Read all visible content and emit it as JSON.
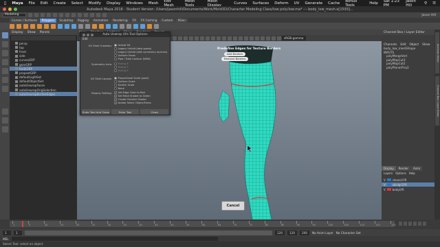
{
  "mac_menubar": {
    "apple": "",
    "app": "Maya",
    "items": [
      "File",
      "Edit",
      "Create",
      "Select",
      "Modify",
      "Display",
      "Windows",
      "Mesh",
      "Edit Mesh",
      "Mesh Tools",
      "Mesh Display",
      "Curves",
      "Surfaces",
      "Deform",
      "UV",
      "Generate",
      "Cache",
      "Bonus Tools",
      "Help"
    ],
    "time": "Sat 1:23 PM",
    "user": "Jason Hill"
  },
  "window_title": "Autodesk Maya 2016 - Student Version: /Users/jasonhill/Documents/Work/Mold3D/Character Modeling Class/low poly/low.ma* --- body_low_mesh.e[1593]...",
  "status_line": {
    "mode": "Modeling",
    "user_label": "Jason Hill"
  },
  "shelf": {
    "tabs": [
      "Curves / Surfaces",
      "Polygons",
      "Sculpting",
      "Rigging",
      "Animation",
      "Rendering",
      "FX",
      "FX Caching",
      "Custom",
      "XGen"
    ],
    "active_tab": "Polygons",
    "icon_colors": [
      "#d98b3a",
      "#d98b3a",
      "#d98b3a",
      "#d98b3a",
      "#d98b3a",
      "#d98b3a",
      "#d98b3a",
      "#5aa0d8",
      "#5aa0d8",
      "#5aa0d8",
      "#8a8a8a",
      "#8a8a8a",
      "#d98b3a",
      "#d98b3a",
      "#5aa0d8",
      "#5aa0d8",
      "#8a8a8a",
      "#8a8a8a",
      "#5aa0d8",
      "#5aa0d8",
      "#d98b3a",
      "#8a8a8a"
    ]
  },
  "outliner": {
    "menu": [
      "Display",
      "Show",
      "Panels"
    ],
    "rows": [
      {
        "label": "persp",
        "selected": false
      },
      {
        "label": "top",
        "selected": false
      },
      {
        "label": "front",
        "selected": false
      },
      {
        "label": "side",
        "selected": false
      },
      {
        "label": "curvesGRP",
        "selected": false
      },
      {
        "label": "gearGRP",
        "selected": false
      },
      {
        "label": "bodyGRP",
        "selected": true
      },
      {
        "label": "propsetGRP",
        "selected": false
      },
      {
        "label": "defaultLightSet",
        "selected": false
      },
      {
        "label": "defaultObjectSet",
        "selected": false
      },
      {
        "label": "autoUnwrapFaces",
        "selected": false
      },
      {
        "label": "autoUnwrapOrigSelection",
        "selected": false
      },
      {
        "label": "autoUnwrapBorderEdges",
        "selected": true
      }
    ]
  },
  "viewport": {
    "menu": [
      "View",
      "Shading",
      "Lighting",
      "Show",
      "Renderer",
      "Panels"
    ],
    "gamma": "sRGB gamma",
    "overlay_title": "Predefine Edges for Texture Borders",
    "pill_add": "Add Borders",
    "pill_remove": "Remove Borders",
    "cancel": "Cancel"
  },
  "dialog": {
    "title": "Auto Unwrap UVs Tool Options",
    "menu": "Edit",
    "uv_shell_creation_label": "UV Shell Creation:",
    "uv_shell_options": [
      {
        "label": "Unfold 3D",
        "on": true,
        "dim": false
      },
      {
        "label": "Legacy Unfold (best guess)",
        "on": false,
        "dim": false
      },
      {
        "label": "Legacy Unfold (with symmetry anchors)",
        "on": false,
        "dim": false
      },
      {
        "label": "Uniform Faces",
        "on": false,
        "dim": false
      },
      {
        "label": "Pipe / Tube Contour (NEW)",
        "on": false,
        "dim": false
      }
    ],
    "symmetry_label": "Symmetry Axis:",
    "symmetry_options": [
      {
        "label": "Facing X",
        "dim": true
      },
      {
        "label": "Facing Y",
        "dim": true
      },
      {
        "label": "Facing Z",
        "dim": true
      }
    ],
    "shell_layout_label": "UV Shell Layout:",
    "shell_layout_options": [
      {
        "label": "Proportional Scale (pack)",
        "on": true
      },
      {
        "label": "Uniform Scale",
        "on": false
      },
      {
        "label": "Stretch Scale",
        "on": false
      },
      {
        "label": "None",
        "on": false
      }
    ],
    "display_label": "Display Setting:",
    "display_options": [
      {
        "label": "Set Edge Color to Red",
        "checked": true
      },
      {
        "label": "Set Mesh Shader to Green",
        "checked": true
      },
      {
        "label": "Create Checker Shader",
        "checked": true
      },
      {
        "label": "Isolate Select Object/Faces",
        "checked": true
      }
    ],
    "buttons": [
      "Enter Tool And Close",
      "Enter Tool",
      "Close"
    ]
  },
  "channel_box": {
    "header": "Channel Box / Layer Editor",
    "object": "body_low_meshShape",
    "inputs_label": "INPUTS",
    "inputs": [
      "polyMergeVert",
      "polyMapCut3",
      "polyMapCut2",
      "polyPlanarProj3"
    ],
    "menu": [
      "Channels",
      "Edit",
      "Object",
      "Show"
    ],
    "layer_tabs": [
      "Display",
      "Render",
      "Anim"
    ],
    "layer_menu": [
      "Layers",
      "Options",
      "Help"
    ],
    "layers": [
      {
        "label": "clones1YR",
        "color": "#2a78c8",
        "selected": false
      },
      {
        "label": "skinlgr1YR",
        "color": "#2a78c8",
        "selected": true
      },
      {
        "label": "bodyLYR",
        "color": "#d43a3a",
        "selected": false
      }
    ]
  },
  "side_tabs": [
    "Attribute Editor",
    "Channel Box / Layer Editor"
  ],
  "timeline": {
    "ticks": [
      "1",
      "5",
      "10",
      "15",
      "20",
      "25",
      "30",
      "35",
      "40",
      "45",
      "50",
      "55",
      "60",
      "65",
      "70",
      "75",
      "80",
      "85",
      "90",
      "95",
      "100",
      "105",
      "110",
      "115",
      "120"
    ],
    "current_frame": "1"
  },
  "range": {
    "start": "1",
    "inner_start": "1",
    "inner_end": "120",
    "end_a": "120",
    "end_b": "200",
    "end_c": "200",
    "anim_layer": "No Anim Layer",
    "char_set": "No Character Set"
  },
  "mel": {
    "label": "MEL"
  },
  "help_line": "Select Tool: select an object"
}
